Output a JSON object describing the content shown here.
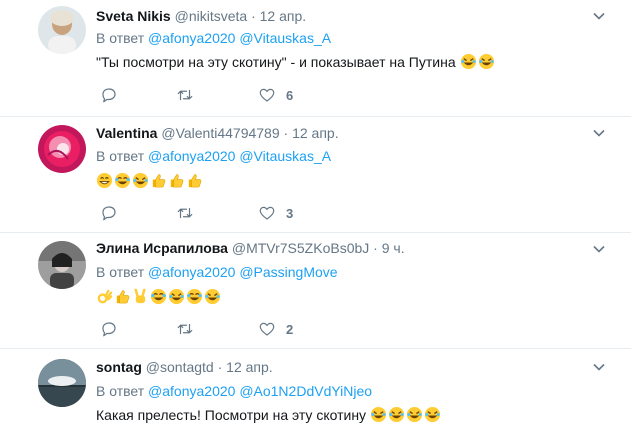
{
  "reply_prefix": "В ответ",
  "tweets": [
    {
      "name": "Sveta Nikis",
      "handle": "@nikitsveta",
      "sep": "·",
      "time": "12 апр.",
      "mentions": [
        "@afonya2020",
        "@Vitauskas_A"
      ],
      "text": "\"Ты посмотри на эту скотину\" - и показывает на Путина",
      "emojis": [
        "rofl",
        "rofl"
      ],
      "likes": "6"
    },
    {
      "name": "Valentina",
      "handle": "@Valenti44794789",
      "sep": "·",
      "time": "12 апр.",
      "mentions": [
        "@afonya2020",
        "@Vitauskas_A"
      ],
      "text": "",
      "emojis": [
        "grin",
        "joy",
        "rofl",
        "thumbsup",
        "thumbsup",
        "thumbsup"
      ],
      "likes": "3"
    },
    {
      "name": "Элина Исрапилова",
      "handle": "@MTVr7S5ZKoBs0bJ",
      "sep": "·",
      "time": "9 ч.",
      "mentions": [
        "@afonya2020",
        "@PassingMove"
      ],
      "text": "",
      "emojis": [
        "ok",
        "thumbsup",
        "victory",
        "joy",
        "rofl",
        "joy",
        "rofl"
      ],
      "likes": "2"
    },
    {
      "name": "sontag",
      "handle": "@sontagtd",
      "sep": "·",
      "time": "12 апр.",
      "mentions": [
        "@afonya2020",
        "@Ao1N2DdVdYiNjeo"
      ],
      "text": "Какая прелесть! Посмотри на эту скотину",
      "emojis": [
        "rofl",
        "rofl",
        "rofl",
        "rofl"
      ],
      "likes": ""
    }
  ],
  "colors": {
    "link": "#1da1f2",
    "muted": "#657786",
    "divider": "#e6ecf0"
  }
}
